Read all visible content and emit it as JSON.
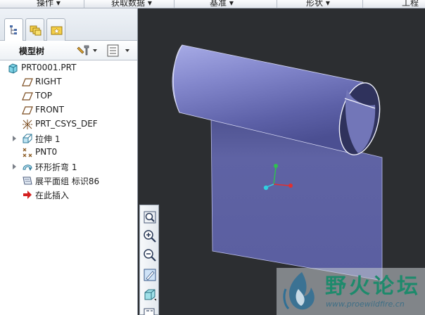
{
  "toolbar": {
    "menus": [
      {
        "label": "操作"
      },
      {
        "label": "获取数据"
      },
      {
        "label": "基准"
      },
      {
        "label": "形状"
      },
      {
        "label": "工程"
      }
    ]
  },
  "panel": {
    "title": "模型树"
  },
  "tree": {
    "items": [
      {
        "label": "PRT0001.PRT",
        "icon": "part-icon",
        "expandable": false
      },
      {
        "label": "RIGHT",
        "icon": "datum-plane-icon",
        "expandable": false
      },
      {
        "label": "TOP",
        "icon": "datum-plane-icon",
        "expandable": false
      },
      {
        "label": "FRONT",
        "icon": "datum-plane-icon",
        "expandable": false
      },
      {
        "label": "PRT_CSYS_DEF",
        "icon": "coordinate-system-icon",
        "expandable": false
      },
      {
        "label": "拉伸 1",
        "icon": "extrude-icon",
        "expandable": true
      },
      {
        "label": "PNT0",
        "icon": "datum-point-icon",
        "expandable": false
      },
      {
        "label": "环形折弯 1",
        "icon": "toroidal-bend-icon",
        "expandable": true
      },
      {
        "label": "展平面组 标识86",
        "icon": "flatten-quilt-icon",
        "expandable": false
      },
      {
        "label": "在此插入",
        "icon": "insert-here-arrow-icon",
        "expandable": false
      }
    ]
  },
  "watermark": {
    "title": "野火论坛",
    "url": "www.proewildfire.cn"
  },
  "colors": {
    "viewport_bg": "#2c2e31",
    "model_surface": "#6f72b4",
    "cylinder": "#8c90d2",
    "axis_x": "#e03030",
    "axis_y": "#30c050",
    "axis_z": "#30d0e0"
  }
}
